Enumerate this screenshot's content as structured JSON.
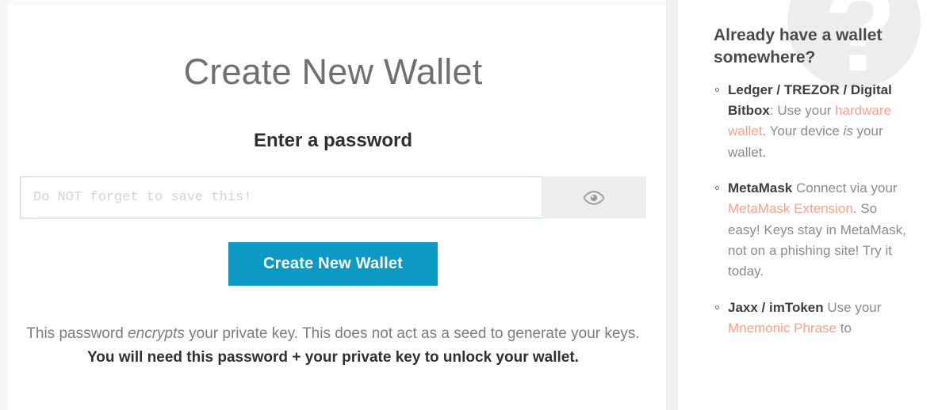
{
  "main": {
    "title": "Create New Wallet",
    "section_label": "Enter a password",
    "password": {
      "value": "",
      "placeholder": "Do NOT forget to save this!",
      "toggle_icon": "eye-icon"
    },
    "submit_label": "Create New Wallet",
    "helper": {
      "part1": "This password ",
      "emphasis": "encrypts",
      "part2": " your private key. This does not act as a seed to generate your keys. ",
      "bold": "You will need this password + your private key to unlock your wallet."
    }
  },
  "sidebar": {
    "watermark": "?",
    "title": "Already have a wallet somewhere?",
    "items": [
      {
        "bold": "Ledger / TREZOR / Digital Bitbox",
        "text_a": ": Use your ",
        "link": "hardware wallet",
        "text_b": ". Your device ",
        "emphasis": "is",
        "text_c": " your wallet."
      },
      {
        "bold": "MetaMask",
        "text_a": " Connect via your ",
        "link": "MetaMask Extension",
        "text_b": ". So easy! Keys stay in MetaMask, not on a phishing site! Try it today.",
        "emphasis": "",
        "text_c": ""
      },
      {
        "bold": "Jaxx / imToken",
        "text_a": " Use your ",
        "link": "Mnemonic Phrase",
        "text_b": " to",
        "emphasis": "",
        "text_c": ""
      }
    ]
  },
  "colors": {
    "accent_blue": "#0c9ac4",
    "link_salmon": "#f7a28b",
    "input_border_pink": "#f3c4bd",
    "title_gray": "#6f7072",
    "body_gray": "#8a8b8d"
  }
}
